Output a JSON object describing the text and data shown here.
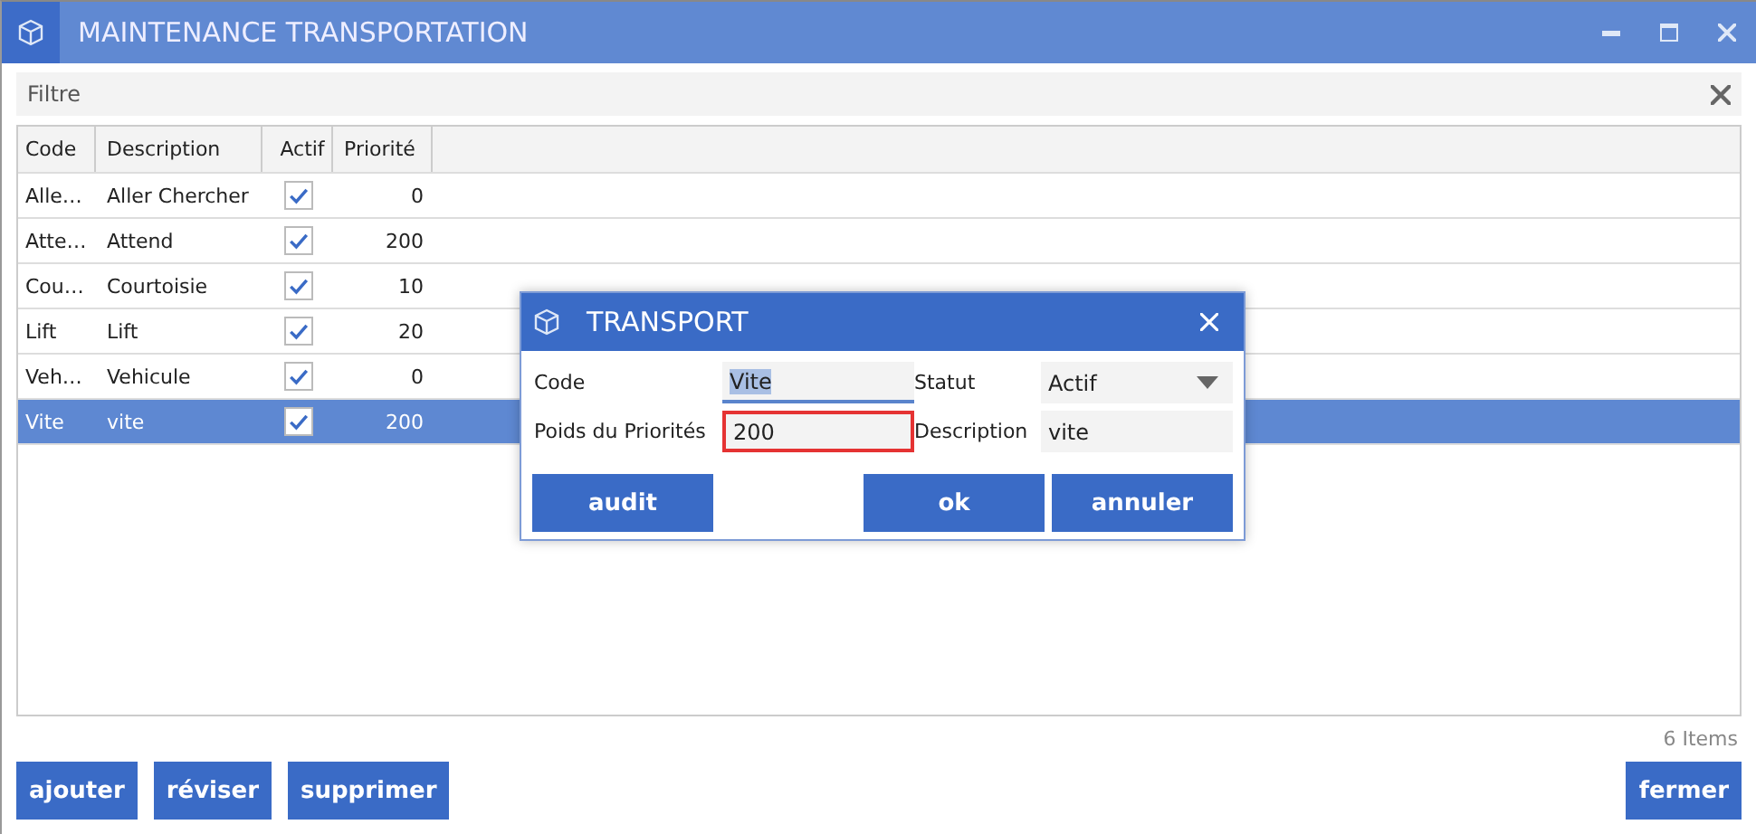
{
  "window": {
    "title": "MAINTENANCE TRANSPORTATION"
  },
  "filter": {
    "placeholder": "Filtre"
  },
  "table": {
    "columns": [
      "Code",
      "Description",
      "Actif",
      "Priorité"
    ],
    "rows": [
      {
        "code": "Alle…",
        "description": "Aller Chercher",
        "active": true,
        "priority": "0",
        "selected": false
      },
      {
        "code": "Atte…",
        "description": "Attend",
        "active": true,
        "priority": "200",
        "selected": false
      },
      {
        "code": "Cou…",
        "description": "Courtoisie",
        "active": true,
        "priority": "10",
        "selected": false
      },
      {
        "code": "Lift",
        "description": "Lift",
        "active": true,
        "priority": "20",
        "selected": false
      },
      {
        "code": "Veh…",
        "description": "Vehicule",
        "active": true,
        "priority": "0",
        "selected": false
      },
      {
        "code": "Vite",
        "description": "vite",
        "active": true,
        "priority": "200",
        "selected": true
      }
    ]
  },
  "item_count": "6 Items",
  "buttons": [
    "ajouter",
    "réviser",
    "supprimer"
  ],
  "close_button": "fermer",
  "dialog": {
    "title": "TRANSPORT",
    "fields": [
      {
        "label": "Code",
        "value": "Vite",
        "focused": true,
        "highlighted": false
      },
      {
        "label": "Statut",
        "value": "Actif",
        "kind": "dropdown"
      },
      {
        "label": "Poids du Priorités",
        "value": "200",
        "focused": false,
        "highlighted": true
      },
      {
        "label": "Description",
        "value": "vite"
      }
    ],
    "buttons": [
      "audit",
      "ok",
      "annuler"
    ]
  }
}
